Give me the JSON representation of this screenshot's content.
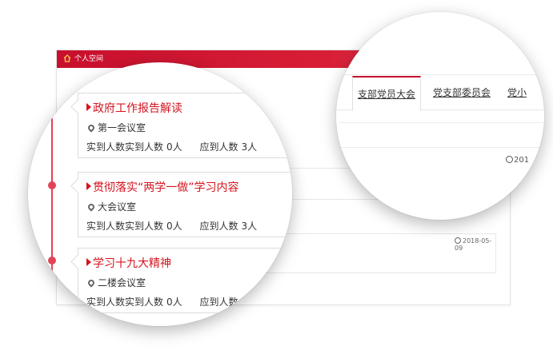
{
  "window": {
    "title": "个人空间"
  },
  "base_dates": [
    "2018-05-09"
  ],
  "timeline": [
    {
      "title": "政府工作报告解读",
      "location": "第一会议室",
      "actual_label": "实到人数实到人数",
      "actual": "0人",
      "expected_label": "应到人数",
      "expected": "3人"
    },
    {
      "title": "贯彻落实“两学一做”学习内容",
      "location": "大会议室",
      "actual_label": "实到人数实到人数",
      "actual": "0人",
      "expected_label": "应到人数",
      "expected": "3人"
    },
    {
      "title": "学习十九大精神",
      "location": "二楼会议室",
      "actual_label": "实到人数实到人数",
      "actual": "0人",
      "expected_label": "应到人数",
      "expected": ""
    }
  ],
  "tabs": [
    {
      "label": "支部党员大会",
      "active": true
    },
    {
      "label": "党支部委员会",
      "active": false
    },
    {
      "label": "党小",
      "active": false
    }
  ],
  "right_date": "201",
  "colors": {
    "accent": "#c8102e",
    "title_red": "#d4151f",
    "timeline": "#e34357"
  }
}
